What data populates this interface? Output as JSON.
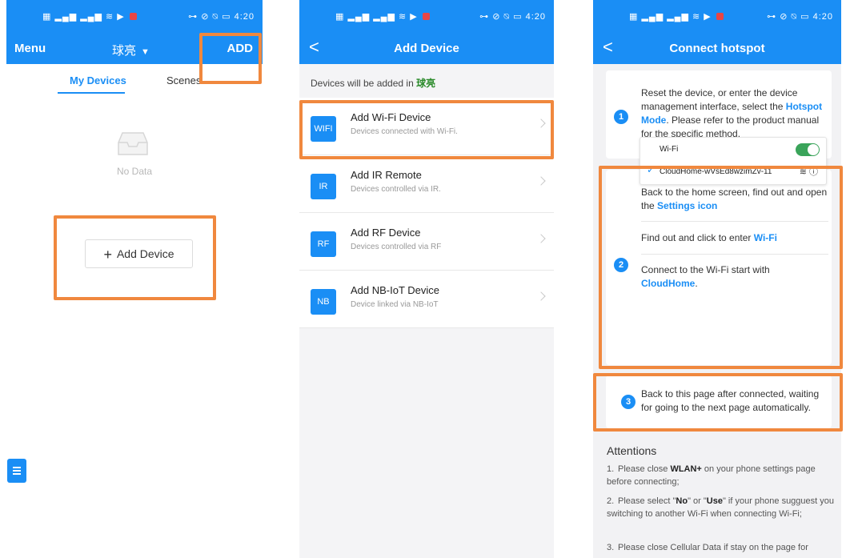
{
  "status": {
    "signal": "⁴ᴳ ᵢₗ ᵢₗ",
    "time": "4:20"
  },
  "screen1": {
    "menu": "Menu",
    "home": "球亮",
    "add": "ADD",
    "tabs": [
      "My Devices",
      "Scenes"
    ],
    "empty_text": "No Data",
    "add_button": "Add Device"
  },
  "screen2": {
    "title": "Add Device",
    "notice_prefix": "Devices will be added in ",
    "notice_home": "球亮",
    "devices": [
      {
        "icon": "WIFI",
        "name": "Add Wi-Fi Device",
        "desc": "Devices connected with Wi-Fi."
      },
      {
        "icon": "IR",
        "name": "Add IR Remote",
        "desc": "Devices controlled via IR."
      },
      {
        "icon": "RF",
        "name": "Add RF Device",
        "desc": "Devices controlled via RF"
      },
      {
        "icon": "NB",
        "name": "Add NB-IoT Device",
        "desc": "Device linked via NB-IoT"
      }
    ]
  },
  "screen3": {
    "title": "Connect hotspot",
    "step1": {
      "num": "1",
      "pre": "Reset the device, or enter the device management interface, select the ",
      "link": "Hotspot Mode",
      "post": ". Please refer to the product manual for the specific method."
    },
    "step2": {
      "num": "2",
      "a_pre": "Back to the home screen, find out and open the ",
      "a_link": "Settings icon",
      "b_pre": "Find out and click to enter ",
      "b_link": "Wi-Fi",
      "c_pre": "Connect to the Wi-Fi start with ",
      "c_link": "CloudHome",
      "c_post": ".",
      "wifi_label": "Wi-Fi",
      "wifi_network": "CloudHome-wVsEd8wzimZv-11"
    },
    "step3": {
      "num": "3",
      "text": "Back to this page after connected, waiting for going to the next page automatically."
    },
    "attentions_title": "Attentions",
    "attentions": [
      {
        "num": "1.",
        "pre": "Please close ",
        "bold": "WLAN+",
        "post": " on your phone settings page before connecting;"
      },
      {
        "num": "2.",
        "pre": "Please select \"",
        "bold": "No",
        "mid": "\" or \"",
        "bold2": "Use",
        "post": "\" if your phone sugguest you switching to another Wi-Fi when connecting Wi-Fi;"
      },
      {
        "num": "3.",
        "pre": "Please close Cellular Data if stay on the page for",
        "bold": "",
        "post": ""
      }
    ]
  }
}
